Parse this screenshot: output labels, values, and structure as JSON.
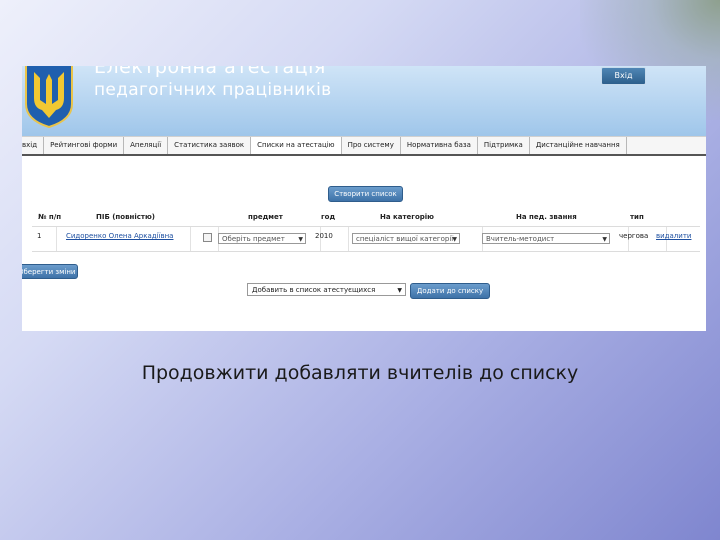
{
  "header": {
    "title_line1": "Електронна атестація",
    "title_line2": "педагогічних працівників",
    "login_label": "Вхід"
  },
  "nav": {
    "items": [
      {
        "label": "вхід"
      },
      {
        "label": "Рейтингові форми"
      },
      {
        "label": "Апеляції"
      },
      {
        "label": "Статистика заявок"
      },
      {
        "label": "Списки на атестацію"
      },
      {
        "label": "Про систему"
      },
      {
        "label": "Нормативна база"
      },
      {
        "label": "Підтримка"
      },
      {
        "label": "Дистанційне навчання"
      }
    ],
    "active_index": 4
  },
  "create_button": "Створити список",
  "table": {
    "headers": [
      "№ п/п",
      "ПІБ (повністю)",
      "предмет",
      "год",
      "На категорію",
      "На пед. звання",
      "тип"
    ],
    "rows": [
      {
        "num": "1",
        "name": "Сидоренко Олена Аркадіївна",
        "subject": "Оберіть предмет",
        "hours": "2010",
        "category": "спеціаліст вищої категорії",
        "title": "Вчитель-методист",
        "type": "чергова",
        "action": "видалити"
      }
    ]
  },
  "save_button": "Зберегти зміни",
  "add_select": "Добавить в список атестуєщихся",
  "add_button": "Додати до списку",
  "caption": "Продовжити добавляти вчителів до списку"
}
